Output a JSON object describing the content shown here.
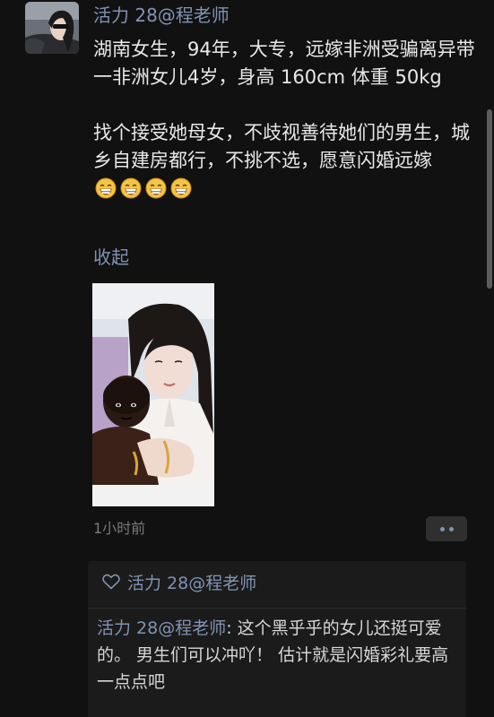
{
  "post": {
    "author": "活力 28@程老师",
    "paragraphs": [
      "湖南女生，94年，大专，远嫁非洲受骗离异带一非洲女儿4岁，身高 160cm 体重 50kg",
      "找个接受她母女，不歧视善待她们的男生，城乡自建房都行，不挑不选，愿意闪婚远嫁"
    ],
    "emoji": [
      "grinning-face-icon",
      "grinning-face-icon",
      "grinning-face-icon",
      "grinning-face-icon"
    ],
    "collapse_label": "收起",
    "timestamp": "1小时前"
  },
  "likes": {
    "names": "活力 28@程老师"
  },
  "comment": {
    "author": "活力 28@程老师",
    "separator": ": ",
    "text": "这个黑乎乎的女儿还挺可爱的。 男生们可以冲吖！  估计就是闪婚彩礼要高一点点吧"
  },
  "colors": {
    "background": "#111111",
    "link": "#8193b3",
    "text": "#e8e8e8",
    "muted": "#7a7a7a",
    "panel": "#1b1b1b"
  }
}
